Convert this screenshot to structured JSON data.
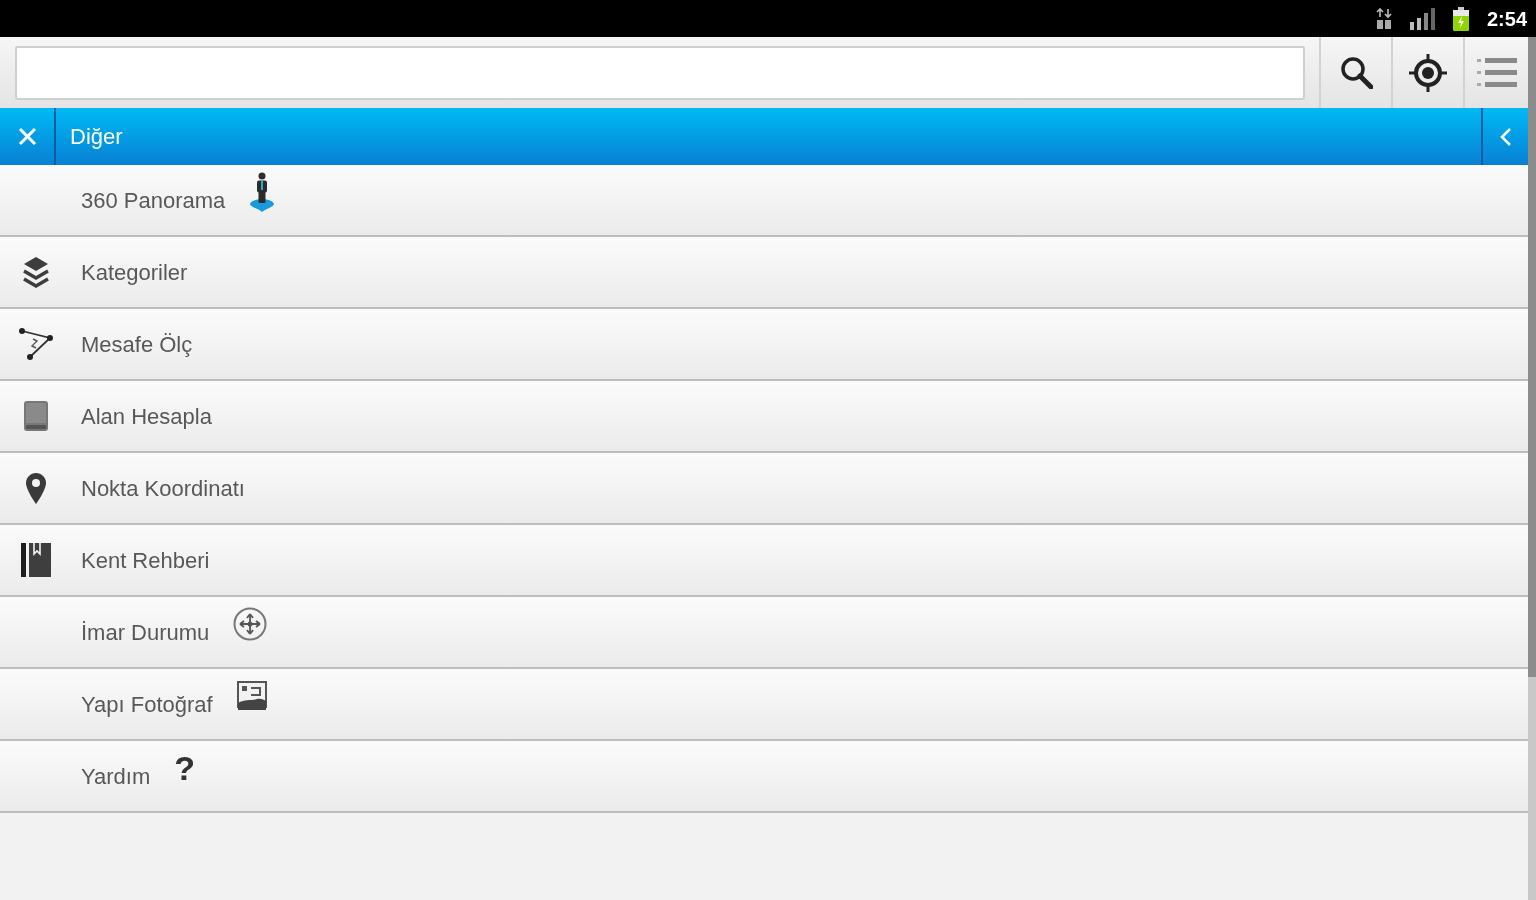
{
  "status_bar": {
    "time": "2:54"
  },
  "panel": {
    "title": "Diğer",
    "items": [
      {
        "label": "360 Panorama",
        "kind": "trailing"
      },
      {
        "label": "Kategoriler",
        "kind": "leading"
      },
      {
        "label": "Mesafe Ölç",
        "kind": "leading"
      },
      {
        "label": "Alan Hesapla",
        "kind": "leading"
      },
      {
        "label": "Nokta Koordinatı",
        "kind": "leading"
      },
      {
        "label": "Kent Rehberi",
        "kind": "leading"
      },
      {
        "label": "İmar Durumu",
        "kind": "trailing"
      },
      {
        "label": "Yapı Fotoğraf",
        "kind": "trailing"
      },
      {
        "label": "Yardım",
        "kind": "trailing",
        "glyph": "?"
      }
    ]
  }
}
